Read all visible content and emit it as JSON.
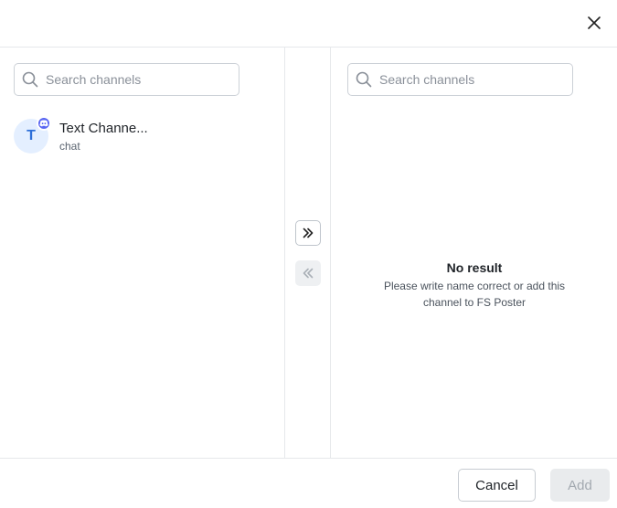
{
  "header": {
    "close_icon": "close-icon"
  },
  "left_panel": {
    "search": {
      "placeholder": "Search channels",
      "value": ""
    },
    "channels": [
      {
        "initial": "T",
        "name": "Text Channe...",
        "subtitle": "chat",
        "platform_icon": "discord-icon",
        "badge_color": "#5865f2"
      }
    ]
  },
  "transfer": {
    "move_right_icon": "double-chevron-right-icon",
    "move_left_icon": "double-chevron-left-icon"
  },
  "right_panel": {
    "search": {
      "placeholder": "Search channels",
      "value": ""
    },
    "empty_title": "No result",
    "empty_description": "Please write name correct or add this channel to FS Poster"
  },
  "footer": {
    "cancel_label": "Cancel",
    "add_label": "Add"
  },
  "colors": {
    "avatar_bg": "#e4efff",
    "avatar_text": "#2d6fd8",
    "disabled_bg": "#e9ebed",
    "disabled_text": "#a3a9b0"
  }
}
